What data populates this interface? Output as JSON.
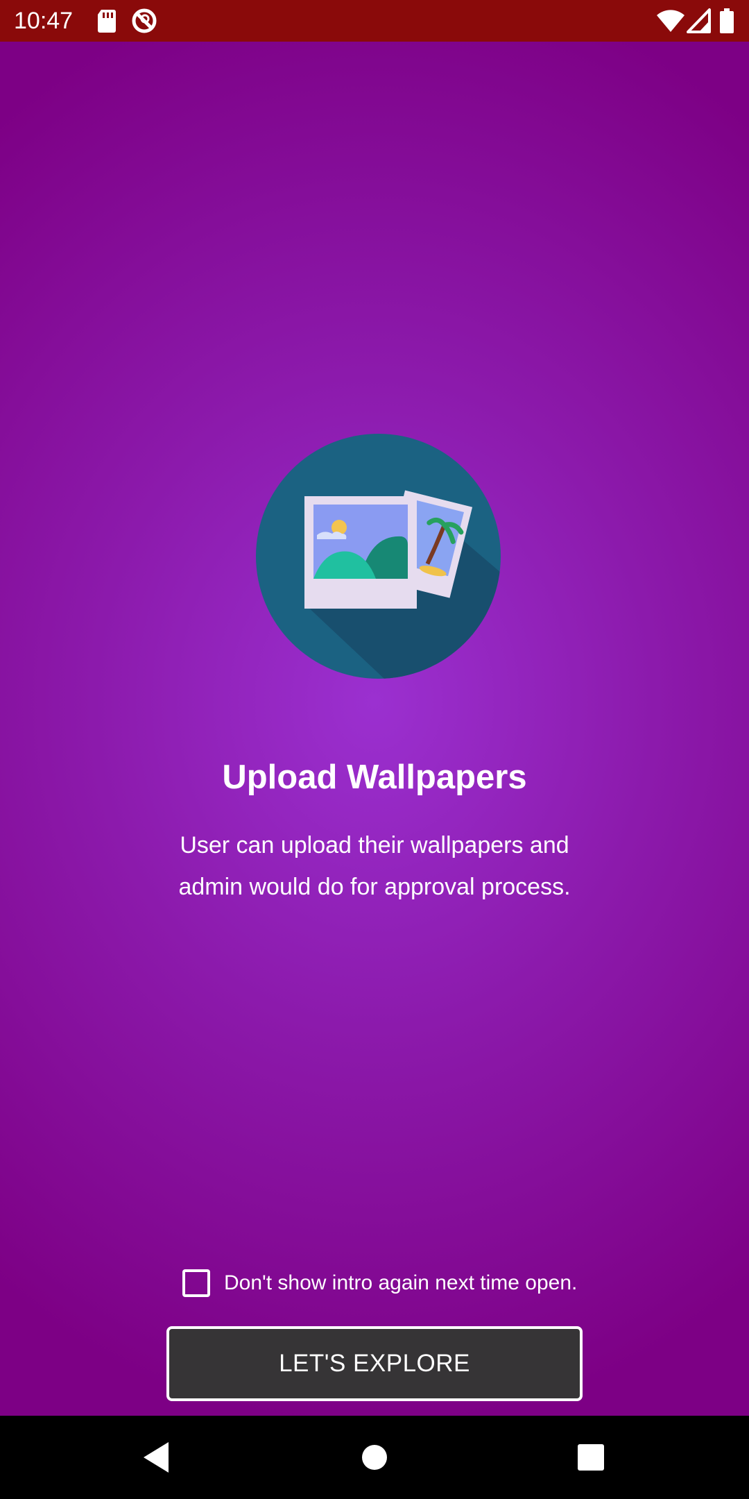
{
  "status_bar": {
    "time": "10:47",
    "left_icons": [
      "sd-card-icon",
      "do-not-disturb-icon"
    ],
    "right_icons": [
      "wifi-icon",
      "signal-icon",
      "battery-icon"
    ],
    "background": "#8a0a0a"
  },
  "intro": {
    "illustration_icon": "photo-gallery-icon",
    "title": "Upload Wallpapers",
    "description": "User can upload their wallpapers and admin would do for approval process.",
    "background_center": "#9b30d0",
    "background_edge": "#7d0085"
  },
  "footer": {
    "dont_show_label": "Don't show intro again next time open.",
    "dont_show_checked": false,
    "explore_button_label": "LET'S EXPLORE",
    "button_color": "#363436"
  },
  "nav_bar": {
    "icons": [
      "back-icon",
      "home-icon",
      "recents-icon"
    ]
  }
}
